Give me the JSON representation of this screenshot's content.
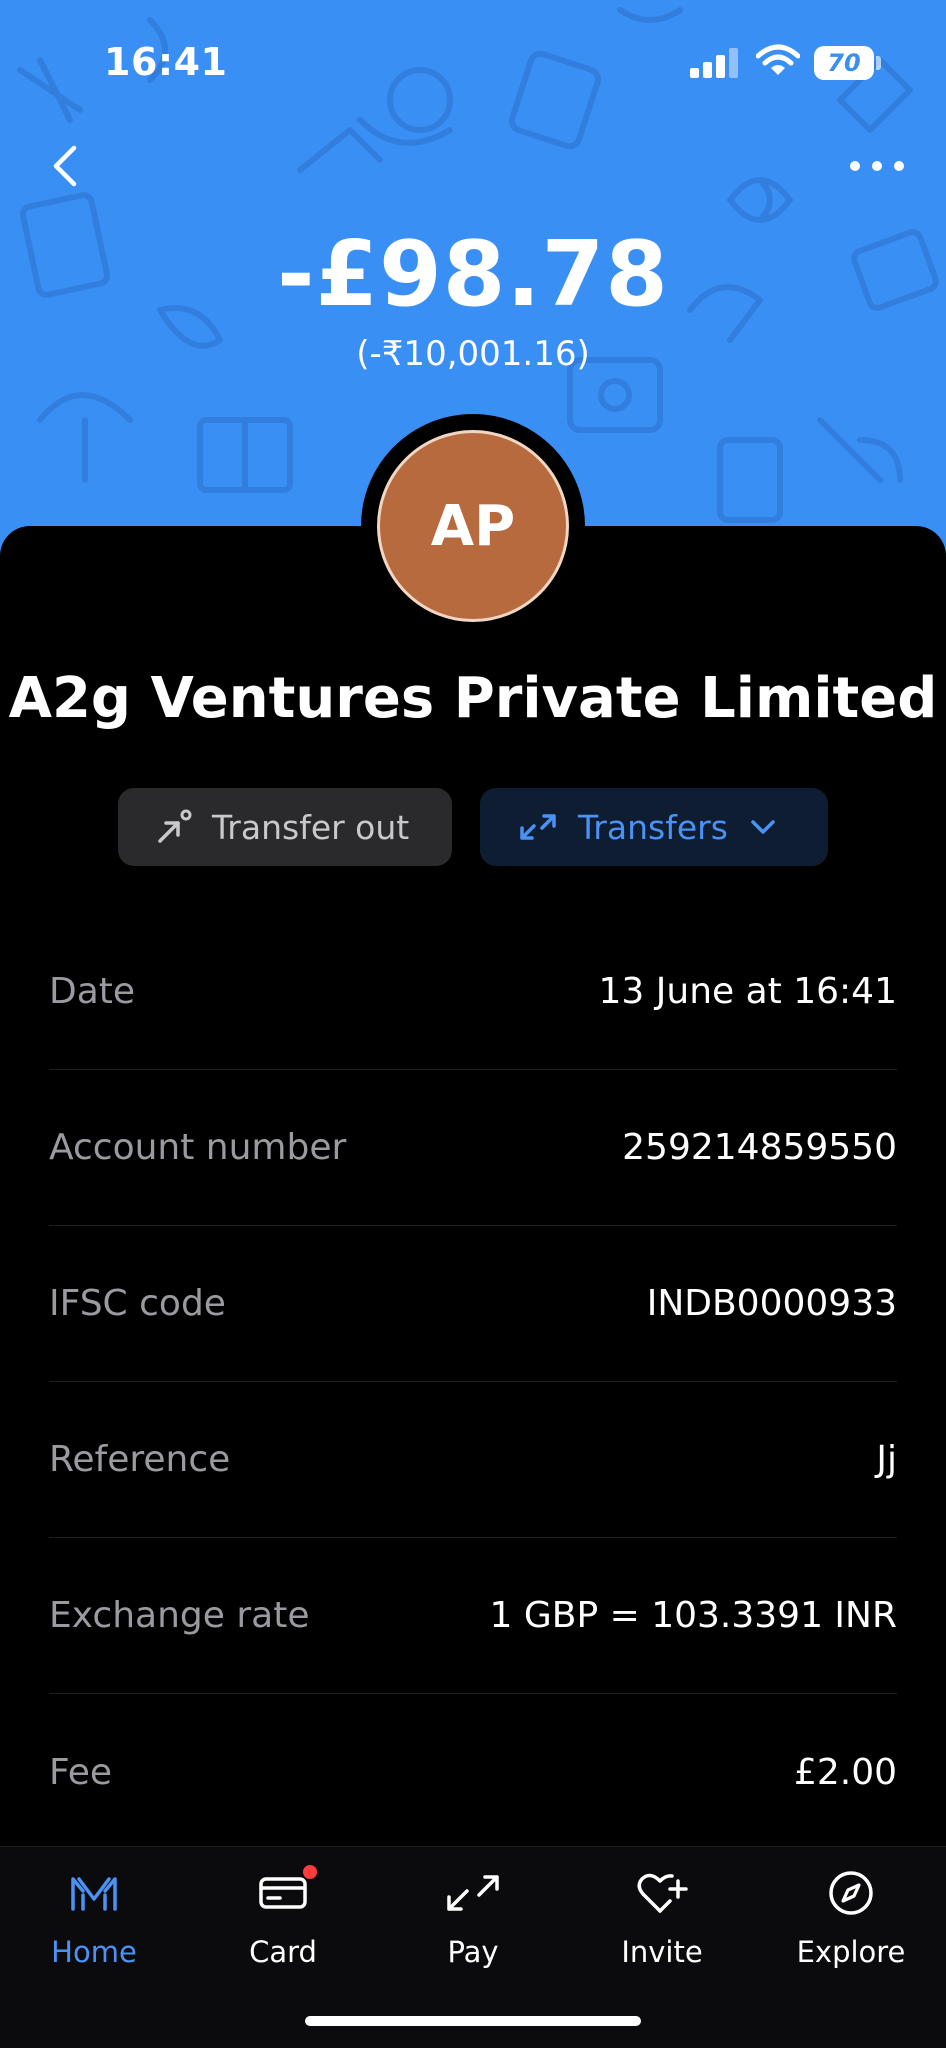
{
  "status_bar": {
    "time": "16:41",
    "battery": "70"
  },
  "transaction": {
    "amount": "-£98.78",
    "converted_amount": "(-₹10,001.16)",
    "avatar_initials": "AP",
    "merchant_name": "A2g Ventures Private Limited"
  },
  "chips": {
    "type_label": "Transfer out",
    "category_label": "Transfers"
  },
  "details": [
    {
      "label": "Date",
      "value": "13 June at 16:41"
    },
    {
      "label": "Account number",
      "value": "259214859550"
    },
    {
      "label": "IFSC code",
      "value": "INDB0000933"
    },
    {
      "label": "Reference",
      "value": "Jj"
    },
    {
      "label": "Exchange rate",
      "value": "1 GBP = 103.3391 INR"
    },
    {
      "label": "Fee",
      "value": "£2.00"
    }
  ],
  "tabbar": {
    "items": [
      {
        "label": "Home",
        "icon": "monzo-logo-icon",
        "active": true
      },
      {
        "label": "Card",
        "icon": "card-icon",
        "active": false
      },
      {
        "label": "Pay",
        "icon": "transfer-arrows-icon",
        "active": false
      },
      {
        "label": "Invite",
        "icon": "heart-plus-icon",
        "active": false
      },
      {
        "label": "Explore",
        "icon": "compass-icon",
        "active": false
      }
    ]
  },
  "colors": {
    "header_blue": "#3a8ff5",
    "accent_blue": "#4a93f5",
    "avatar_bg": "#b86a3f",
    "notification_red": "#ff3b3b"
  }
}
